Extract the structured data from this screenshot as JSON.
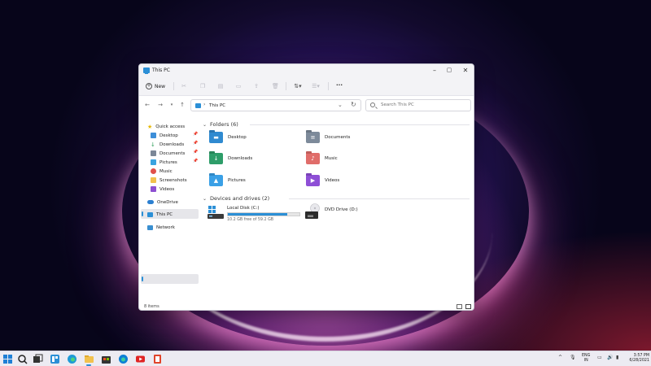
{
  "window": {
    "title": "This PC"
  },
  "command_bar": {
    "new_label": "New",
    "more_label": "..."
  },
  "address_bar": {
    "location": "This PC",
    "search_placeholder": "Search This PC"
  },
  "sidebar": {
    "quick_access": {
      "label": "Quick access",
      "items": [
        {
          "label": "Desktop",
          "pinned": true,
          "icon": "desktop-icon",
          "color": "#3d8ed8"
        },
        {
          "label": "Downloads",
          "pinned": true,
          "icon": "download-icon",
          "color": "#2f9e5a"
        },
        {
          "label": "Documents",
          "pinned": true,
          "icon": "document-icon",
          "color": "#7b8797"
        },
        {
          "label": "Pictures",
          "pinned": true,
          "icon": "picture-icon",
          "color": "#3aa3e0"
        },
        {
          "label": "Music",
          "pinned": false,
          "icon": "music-icon",
          "color": "#e0504a"
        },
        {
          "label": "Screenshots",
          "pinned": false,
          "icon": "folder-icon",
          "color": "#f2c14e"
        },
        {
          "label": "Videos",
          "pinned": false,
          "icon": "video-icon",
          "color": "#8d4fd1"
        }
      ]
    },
    "onedrive_label": "OneDrive",
    "this_pc_label": "This PC",
    "network_label": "Network"
  },
  "folders": {
    "header": "Folders (6)",
    "items": [
      {
        "label": "Desktop",
        "icon": "desktop-folder-icon",
        "color": "#2f8ad0"
      },
      {
        "label": "Documents",
        "icon": "documents-folder-icon",
        "color": "#7d8a9a"
      },
      {
        "label": "Downloads",
        "icon": "downloads-folder-icon",
        "color": "#2e9d69"
      },
      {
        "label": "Music",
        "icon": "music-folder-icon",
        "color": "#e06d6a"
      },
      {
        "label": "Pictures",
        "icon": "pictures-folder-icon",
        "color": "#3aa0e6"
      },
      {
        "label": "Videos",
        "icon": "videos-folder-icon",
        "color": "#8e4fd6"
      }
    ]
  },
  "devices": {
    "header": "Devices and drives (2)",
    "local_disk": {
      "label": "Local Disk (C:)",
      "free_text": "10.2 GB free of 59.2 GB",
      "used_fraction": 0.83
    },
    "dvd_drive": {
      "label": "DVD Drive (D:)"
    }
  },
  "status_bar": {
    "item_count": "8 items"
  },
  "taskbar": {
    "lang_top": "ENG",
    "lang_bottom": "IN",
    "time": "3:57 PM",
    "date": "6/28/2021"
  },
  "colors": {
    "accent": "#2b8fd6",
    "selection": "#e6e6ea"
  }
}
